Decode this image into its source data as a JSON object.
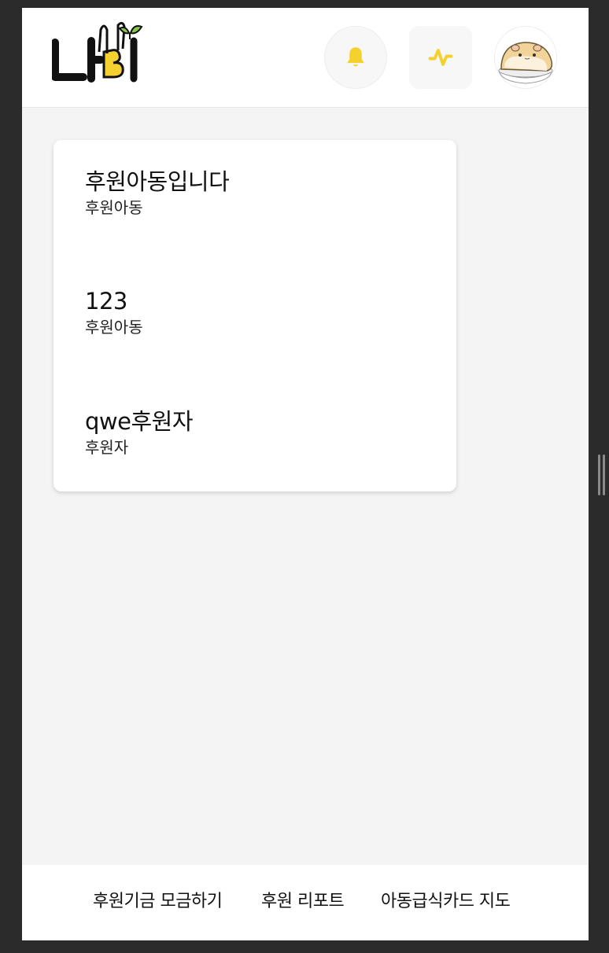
{
  "header": {
    "logo_text": "나비",
    "icons": {
      "notification": "bell-icon",
      "activity": "activity-icon",
      "profile": "avatar"
    }
  },
  "entries": [
    {
      "name": "후원아동입니다",
      "role": "후원아동"
    },
    {
      "name": "123",
      "role": "후원아동"
    },
    {
      "name": "qwe후원자",
      "role": "후원자"
    }
  ],
  "footer": {
    "links": [
      "후원기금 모금하기",
      "후원 리포트",
      "아동급식카드 지도"
    ]
  },
  "colors": {
    "accent": "#f5d130",
    "logo_green": "#86c64a",
    "background": "#f4f4f4",
    "outer": "#2b2b2b"
  }
}
